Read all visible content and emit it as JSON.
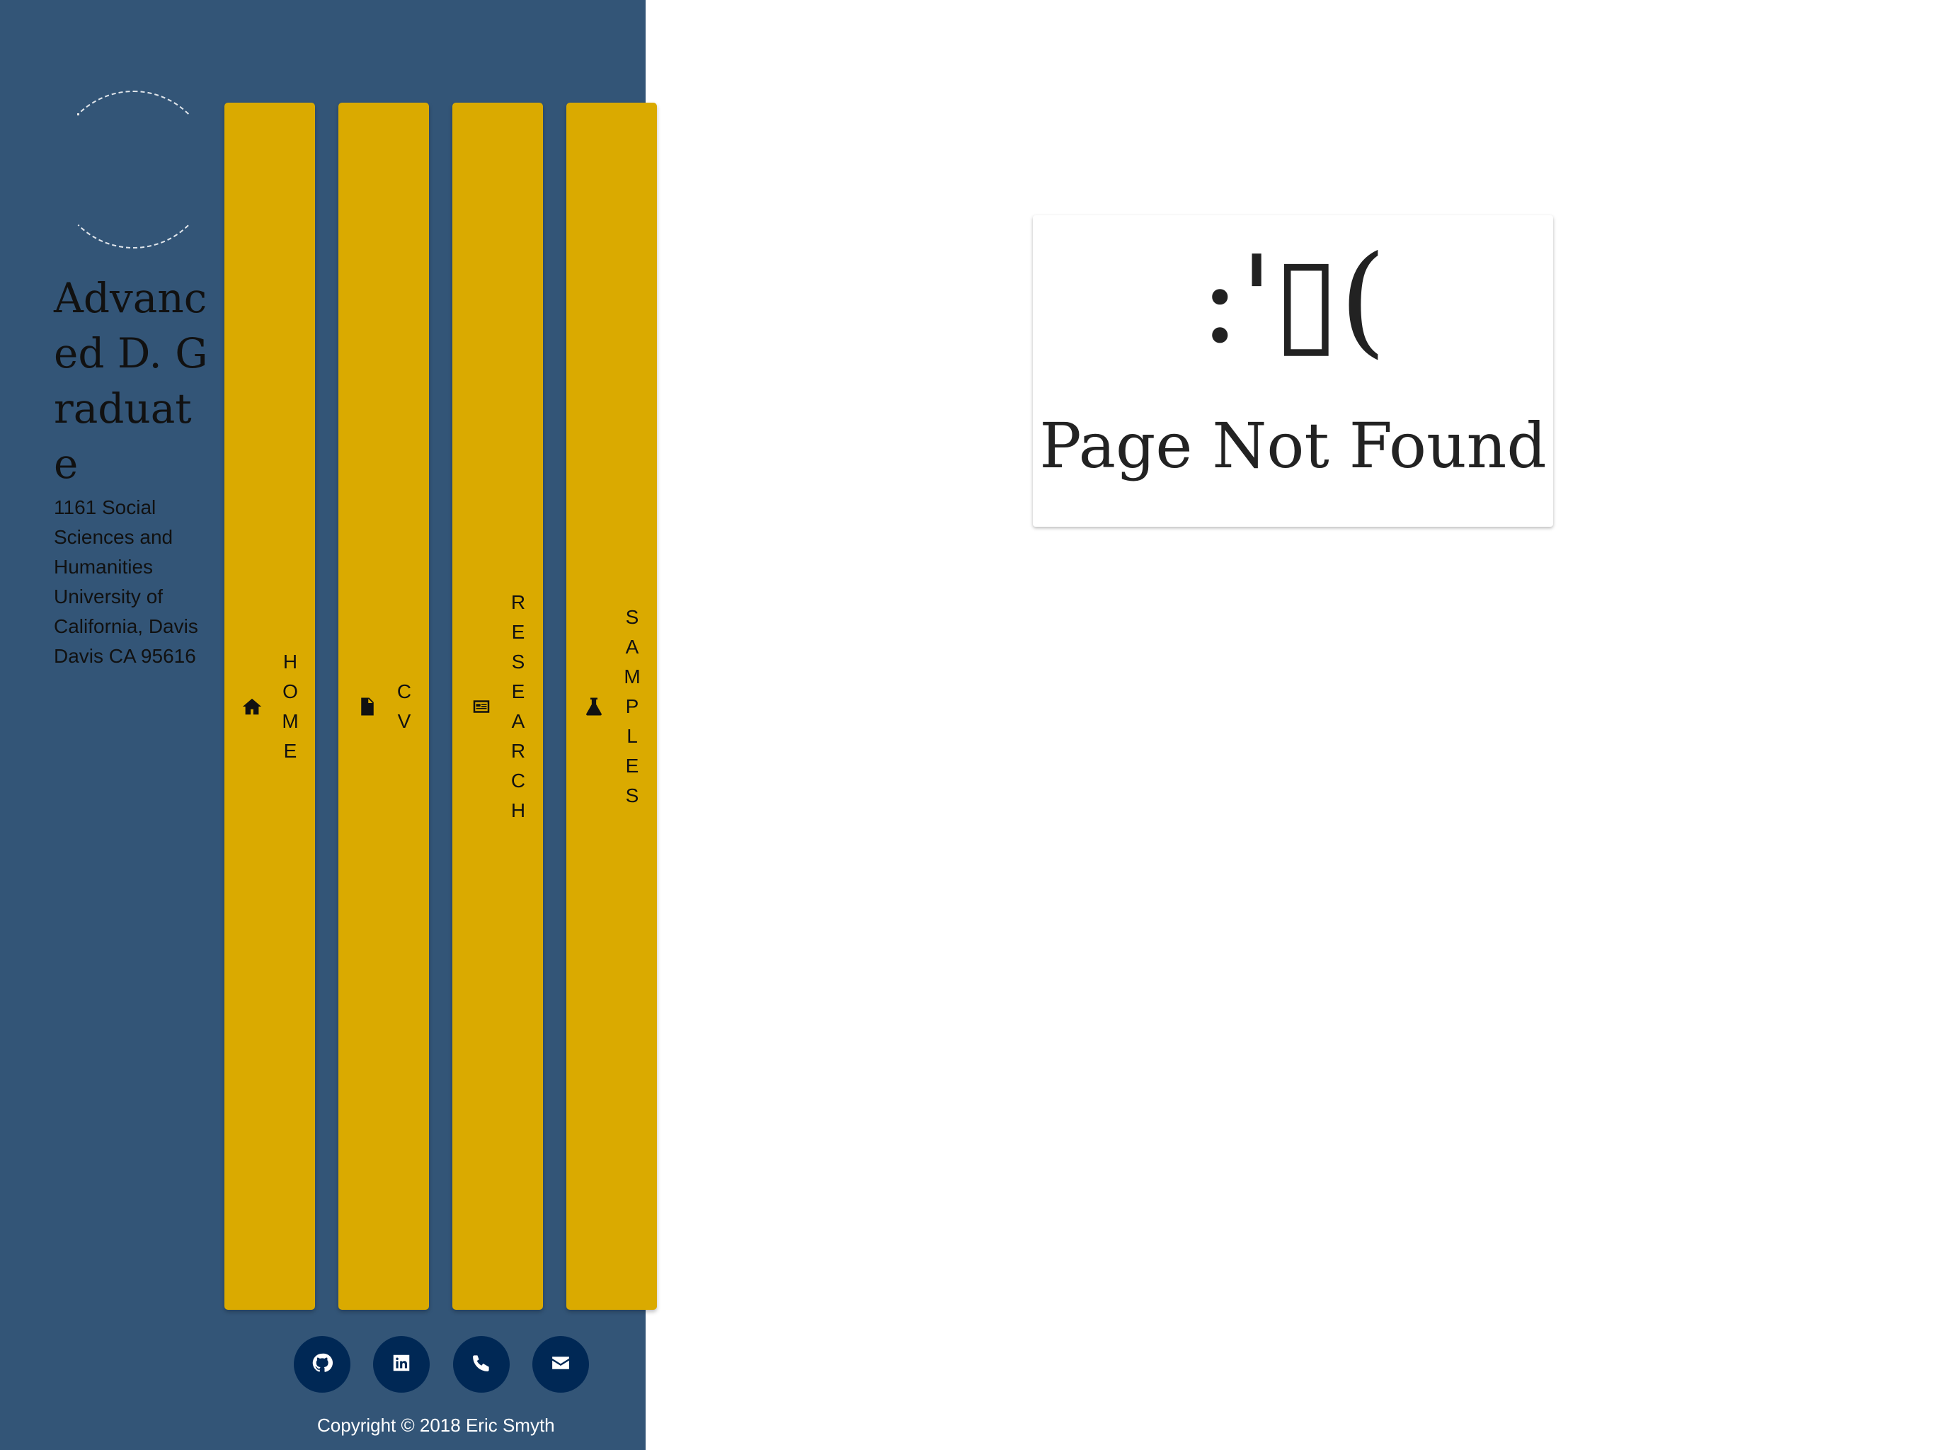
{
  "sidebar": {
    "name": "Advanced D. Graduate",
    "address": "1161 Social Sciences and Humanities University of California, Davis Davis CA 95616",
    "avatar_alt": "profile photo",
    "colors": {
      "background": "#335577",
      "tab": "#daaa00",
      "social": "#002855"
    }
  },
  "nav": {
    "items": [
      {
        "label": "HOME",
        "icon": "home-icon"
      },
      {
        "label": "CV",
        "icon": "file-icon"
      },
      {
        "label": "RESEARCH",
        "icon": "newspaper-icon"
      },
      {
        "label": "SAMPLES",
        "icon": "flask-icon"
      }
    ]
  },
  "social": {
    "items": [
      {
        "icon": "github-icon"
      },
      {
        "icon": "linkedin-icon"
      },
      {
        "icon": "phone-icon"
      },
      {
        "icon": "envelope-icon"
      }
    ]
  },
  "footer": {
    "copyright": "Copyright © 2018 Eric Smyth"
  },
  "error": {
    "face": ":'▯(",
    "message": "Page Not Found"
  }
}
